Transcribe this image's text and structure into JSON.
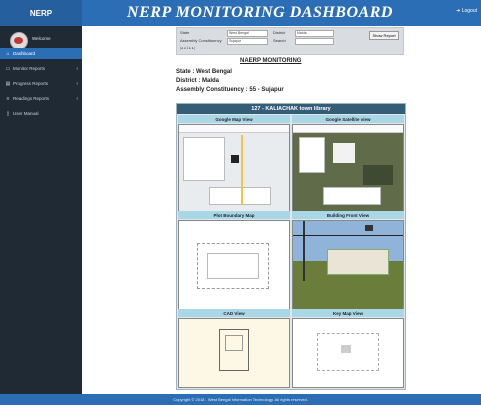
{
  "header": {
    "brand": "NERP",
    "title": "NERP MONITORING DASHBOARD",
    "logout": "➜ Logout"
  },
  "sidebar": {
    "welcome": "Welcome",
    "items": [
      {
        "label": "Dashboard",
        "icon": "home-icon",
        "glyph": "⌂"
      },
      {
        "label": "Monitor Reports",
        "icon": "monitor-icon",
        "glyph": "▭"
      },
      {
        "label": "Progress Reports",
        "icon": "chart-icon",
        "glyph": "▤"
      },
      {
        "label": "Readings Reports",
        "icon": "list-icon",
        "glyph": "≡"
      },
      {
        "label": "User Manual",
        "icon": "book-icon",
        "glyph": "▯"
      }
    ]
  },
  "filters": {
    "state_label": "State",
    "state_value": "West Bengal",
    "district_label": "District",
    "district_value": "Malda",
    "search_label": "Search",
    "constituency_label": "Assembly Constituency",
    "constituency_value": "Sujapur",
    "search_button": "Show Report"
  },
  "report": {
    "heading": "NAERP MONITORING",
    "state": "State : West Bengal",
    "district": "District : Malda",
    "constituency": "Assembly Constituency : 55 - Sujapur",
    "panel_title": "127 - KALIACHAK town library",
    "captions": [
      "Google Map View",
      "Google Satellite view",
      "Plot Boundary Map",
      "Building Front View",
      "CAD View",
      "Key Map View"
    ]
  },
  "footer": {
    "text": "Copyright © 2018 - West Bengal Information Technology. All rights reserved."
  }
}
